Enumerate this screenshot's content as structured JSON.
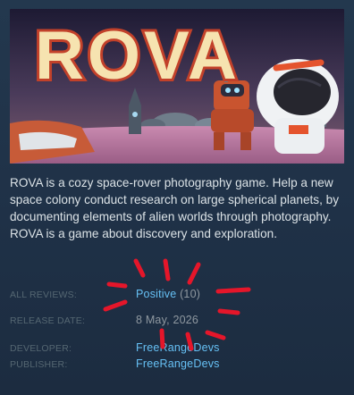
{
  "game": {
    "title_art": "ROVA",
    "description": "ROVA is a cozy space-rover photography game. Help a new space colony conduct research on large spherical planets, by documenting elements of alien worlds through photography. ROVA is a game about discovery and exploration."
  },
  "details": {
    "reviews": {
      "label": "ALL REVIEWS:",
      "summary": "Positive",
      "count": "(10)"
    },
    "release": {
      "label": "RELEASE DATE:",
      "value": "8 May, 2026"
    },
    "developer": {
      "label": "DEVELOPER:",
      "value": "FreeRangeDevs"
    },
    "publisher": {
      "label": "PUBLISHER:",
      "value": "FreeRangeDevs"
    }
  },
  "colors": {
    "link": "#66c0f4",
    "label": "#556772",
    "text": "#dbe2e6",
    "scribble": "#e5162a"
  }
}
